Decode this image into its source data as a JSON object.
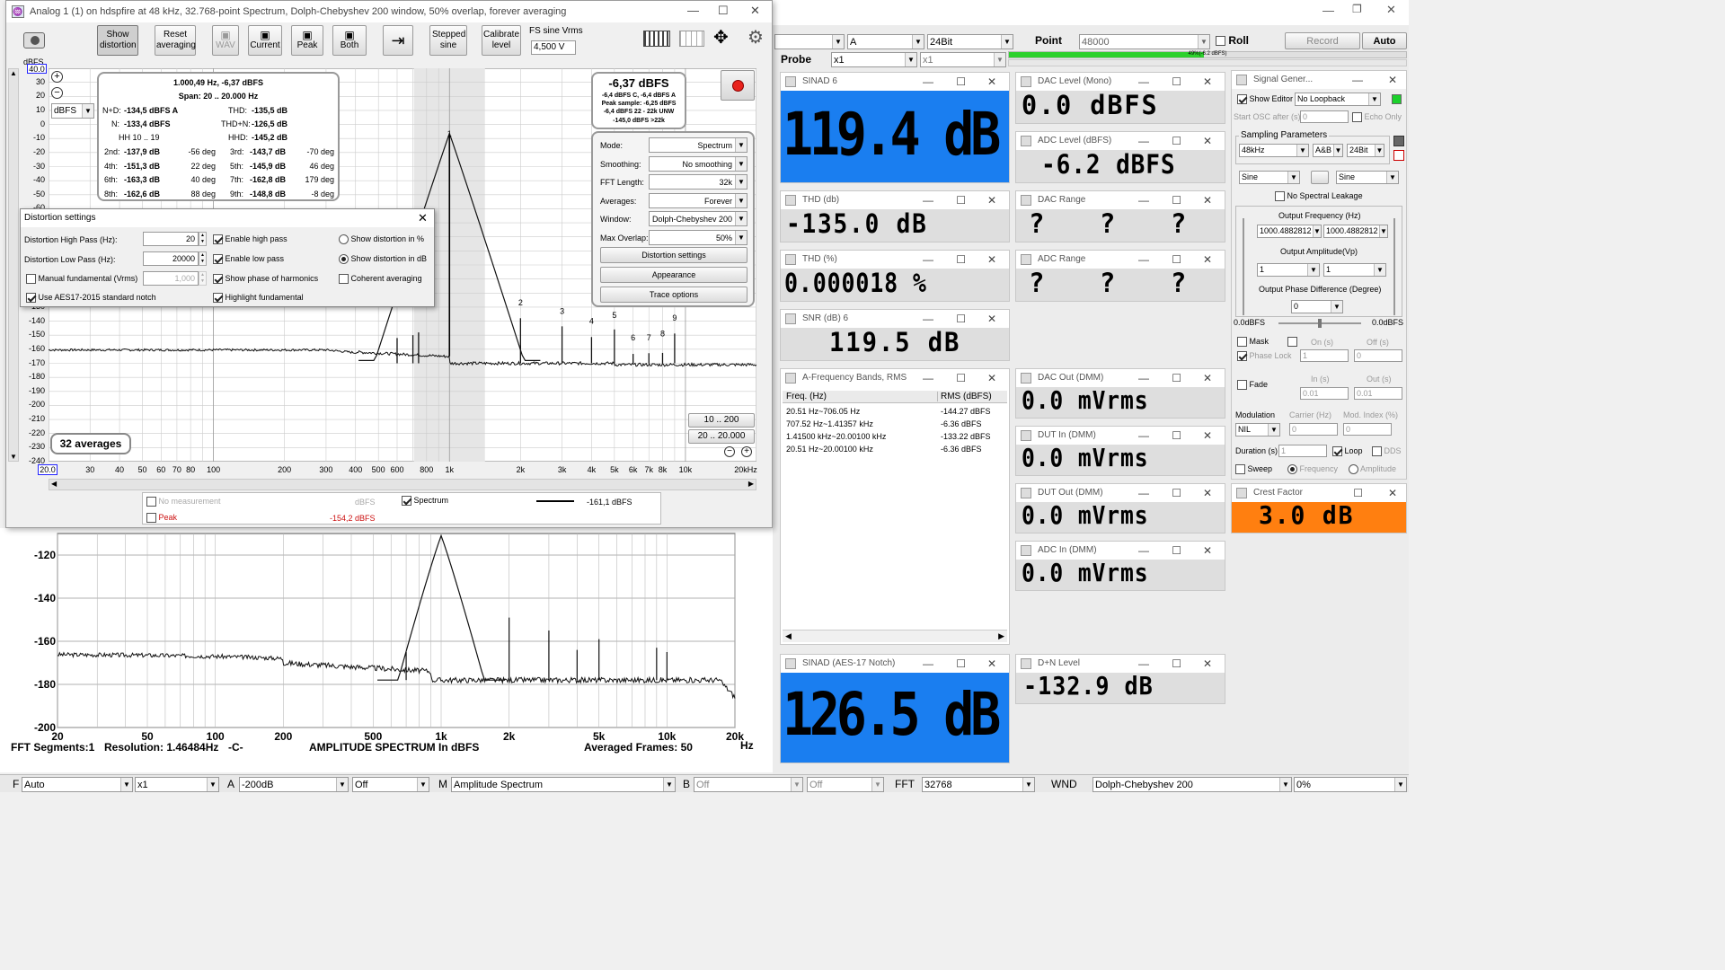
{
  "window": {
    "title": "Analog 1 (1) on hdspfire at 48 kHz, 32.768-point Spectrum, Dolph-Chebyshev 200 window, 50% overlap, forever averaging"
  },
  "toolbar": {
    "show_distortion": "Show distortion",
    "reset_averaging": "Reset averaging",
    "wav": "WAV",
    "current": "Current",
    "peak": "Peak",
    "both": "Both",
    "stepped_sine": "Stepped sine",
    "calibrate_level": "Calibrate level",
    "fs_sine_label": "FS sine Vrms",
    "fs_sine_value": "4,500 V"
  },
  "plot": {
    "ylabel": "dBFS",
    "ymax_box": "40.0",
    "unit": "dBFS",
    "yticks": [
      "30",
      "20",
      "10",
      "0",
      "-10",
      "-20",
      "-30",
      "-40",
      "-50",
      "-60",
      "-70",
      "-80",
      "-90",
      "-100",
      "-110",
      "-120",
      "-130",
      "-140",
      "-150",
      "-160",
      "-170",
      "-180",
      "-190",
      "-200",
      "-210",
      "-220",
      "-230",
      "-240"
    ],
    "xticks": [
      "30",
      "40",
      "50",
      "60",
      "70",
      "80",
      "100",
      "200",
      "300",
      "400",
      "500",
      "600",
      "800",
      "1k",
      "2k",
      "3k",
      "4k",
      "5k",
      "6k",
      "7k",
      "8k",
      "10k",
      "20kHz"
    ],
    "xmin_box": "20.0",
    "harmonics": [
      "1",
      "2",
      "3",
      "4",
      "5",
      "6",
      "7",
      "8",
      "9"
    ],
    "averages": "32 averages",
    "range_btn1": "10 .. 200",
    "range_btn2": "20 .. 20.000"
  },
  "dist_box": {
    "line1": "1.000,49 Hz, -6,37 dBFS",
    "line2": "Span: 20 .. 20.000 Hz",
    "nd_l": "N+D:",
    "nd_v": "-134,5 dBFS A",
    "thd_l": "THD:",
    "thd_v": "-135,5 dB",
    "n_l": "N:",
    "n_v": "-133,4 dBFS",
    "thdn_l": "THD+N:",
    "thdn_v": "-126,5 dB",
    "hh_l": "HH 10 .. 19",
    "hhd_l": "HHD:",
    "hhd_v": "-145,2 dB",
    "rows": [
      {
        "a": "2nd:",
        "av": "-137,9 dB",
        "ad": "-56 deg",
        "b": "3rd:",
        "bv": "-143,7 dB",
        "bd": "-70 deg"
      },
      {
        "a": "4th:",
        "av": "-151,3 dB",
        "ad": "22 deg",
        "b": "5th:",
        "bv": "-145,9 dB",
        "bd": "46 deg"
      },
      {
        "a": "6th:",
        "av": "-163,3 dB",
        "ad": "40 deg",
        "b": "7th:",
        "bv": "-162,8 dB",
        "bd": "179 deg"
      },
      {
        "a": "8th:",
        "av": "-162,6 dB",
        "ad": "88 deg",
        "b": "9th:",
        "bv": "-148,8 dB",
        "bd": "-8 deg"
      }
    ]
  },
  "level_box": {
    "main": "-6,37 dBFS",
    "l1": "-6,4 dBFS C, -6,4 dBFS A",
    "l2": "Peak sample: -6,25 dBFS",
    "l3": "-6,4 dBFS 22 - 22k UNW",
    "l4": "-145,0 dBFS >22k"
  },
  "settings": {
    "mode_l": "Mode:",
    "mode_v": "Spectrum",
    "smooth_l": "Smoothing:",
    "smooth_v": "No smoothing",
    "fft_l": "FFT Length:",
    "fft_v": "32k",
    "avg_l": "Averages:",
    "avg_v": "Forever",
    "win_l": "Window:",
    "win_v": "Dolph-Chebyshev 200",
    "ovl_l": "Max Overlap:",
    "ovl_v": "50%",
    "b1": "Distortion settings",
    "b2": "Appearance",
    "b3": "Trace options"
  },
  "dist_dialog": {
    "title": "Distortion settings",
    "hp_l": "Distortion High Pass (Hz):",
    "hp_v": "20",
    "lp_l": "Distortion Low Pass (Hz):",
    "lp_v": "20000",
    "manual_l": "Manual fundamental (Vrms)",
    "manual_v": "1,000",
    "aes_l": "Use AES17-2015 standard notch",
    "en_hp": "Enable high pass",
    "en_lp": "Enable low pass",
    "phase": "Show phase of harmonics",
    "highlight": "Highlight fundamental",
    "pct": "Show distortion in %",
    "db": "Show distortion in dB",
    "coherent": "Coherent averaging"
  },
  "legend": {
    "nomeas": "No measurement",
    "nomeas_u": "dBFS",
    "spectrum": "Spectrum",
    "spectrum_v": "-161,1 dBFS",
    "peak": "Peak",
    "peak_v": "-154,2 dBFS"
  },
  "lower_plot": {
    "yticks": [
      "-120",
      "-140",
      "-160",
      "-180",
      "-200"
    ],
    "xticks": [
      "20",
      "50",
      "100",
      "200",
      "500",
      "1k",
      "2k",
      "5k",
      "10k",
      "20k"
    ],
    "hz": "Hz",
    "footer_segments": "FFT Segments:1",
    "footer_res": "Resolution: 1.46484Hz",
    "footer_c": "-C-",
    "footer_title": "AMPLITUDE SPECTRUM In dBFS",
    "footer_frames": "Averaged Frames: 50"
  },
  "top_strip": {
    "sel_a": "A",
    "bits": "24Bit",
    "point_l": "Point",
    "point_v": "48000",
    "roll": "Roll",
    "record": "Record",
    "auto": "Auto",
    "probe": "Probe",
    "x1a": "x1",
    "x1b": "x1",
    "level_bar": "49%(-6.2 dBFS)"
  },
  "meters": {
    "sinad": {
      "title": "SINAD  6",
      "value": "119.4 dB"
    },
    "dac_level": {
      "title": "DAC Level (Mono)",
      "value": "0.0 dBFS"
    },
    "adc_level": {
      "title": "ADC Level (dBFS)",
      "value": "-6.2 dBFS"
    },
    "thd_db": {
      "title": "THD (db)",
      "value": "-135.0 dB"
    },
    "dac_range": {
      "title": "DAC Range",
      "value": "? ? ?"
    },
    "thd_pct": {
      "title": "THD (%)",
      "value": "0.000018 %"
    },
    "adc_range": {
      "title": "ADC Range",
      "value": "? ? ?"
    },
    "snr": {
      "title": "SNR (dB)  6",
      "value": "119.5 dB"
    },
    "dac_out": {
      "title": "DAC Out (DMM)",
      "value": "0.0 mVrms"
    },
    "dut_in": {
      "title": "DUT In (DMM)",
      "value": "0.0 mVrms"
    },
    "dut_out": {
      "title": "DUT Out (DMM)",
      "value": "0.0 mVrms"
    },
    "adc_in": {
      "title": "ADC In (DMM)",
      "value": "0.0 mVrms"
    },
    "sinad_aes": {
      "title": "SINAD (AES-17 Notch)",
      "value": "126.5 dB"
    },
    "dn_level": {
      "title": "D+N Level",
      "value": "-132.9 dB"
    },
    "crest": {
      "title": "Crest Factor",
      "value": "3.0 dB"
    }
  },
  "bands": {
    "title": "A-Frequency Bands, RMS",
    "h1": "Freq. (Hz)",
    "h2": "RMS (dBFS)",
    "rows": [
      {
        "f": "20.51 Hz~706.05 Hz",
        "v": "-144.27 dBFS"
      },
      {
        "f": "707.52 Hz~1.41357 kHz",
        "v": "-6.36 dBFS"
      },
      {
        "f": "1.41500 kHz~20.00100 kHz",
        "v": "-133.22 dBFS"
      },
      {
        "f": "20.51 Hz~20.00100 kHz",
        "v": "-6.36 dBFS"
      }
    ]
  },
  "siggen": {
    "title": "Signal Gener...",
    "show_editor": "Show Editor",
    "loopback": "No Loopback",
    "start_osc": "Start OSC after (s)",
    "start_v": "0",
    "echo": "Echo Only",
    "sampling": "Sampling Parameters",
    "sr": "48kHz",
    "ch": "A&B",
    "bits": "24Bit",
    "wave1": "Sine",
    "wave2": "Sine",
    "nsl": "No Spectral Leakage",
    "of_l": "Output Frequency (Hz)",
    "of1": "1000.4882812",
    "of2": "1000.4882812",
    "oa_l": "Output Amplitude(Vp)",
    "oa1": "1",
    "oa2": "1",
    "opd_l": "Output Phase Difference (Degree)",
    "opd_v": "0",
    "db_l": "0.0dBFS",
    "db_r": "0.0dBFS",
    "mask": "Mask",
    "on_l": "On (s)",
    "off_l": "Off (s)",
    "phase_lock": "Phase Lock",
    "pl1": "1",
    "pl2": "0",
    "fade": "Fade",
    "in_l": "In (s)",
    "out_l": "Out (s)",
    "in_v": "0.01",
    "out_v": "0.01",
    "mod": "Modulation",
    "carrier": "Carrier (Hz)",
    "modidx": "Mod. Index (%)",
    "nil": "NIL",
    "c_v": "0",
    "m_v": "0",
    "duration": "Duration (s)",
    "dur_v": "1",
    "loop": "Loop",
    "dds": "DDS",
    "sweep": "Sweep",
    "freq": "Frequency",
    "amp": "Amplitude"
  },
  "bottom": {
    "f_l": "F",
    "f_v": "Auto",
    "x1": "x1",
    "a_l": "A",
    "a_v": "-200dB",
    "off1": "Off",
    "m_l": "M",
    "m_v": "Amplitude Spectrum",
    "b_l": "B",
    "off2": "Off",
    "off3": "Off",
    "fft_l": "FFT",
    "fft_v": "32768",
    "wnd_l": "WND",
    "wnd_v": "Dolph-Chebyshev 200",
    "pct": "0%"
  },
  "colors": {
    "blue": "#1a7ef0",
    "orange": "#ff7f10",
    "grey_meter": "#dcdcdc"
  }
}
